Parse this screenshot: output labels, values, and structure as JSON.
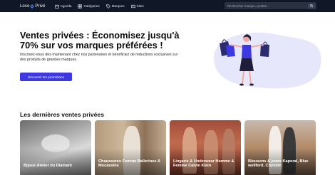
{
  "header": {
    "brand_left": "Loco",
    "brand_right": "Privé",
    "links": [
      {
        "label": "Agenda",
        "icon": "calendar-icon"
      },
      {
        "label": "Catégories",
        "icon": "grid-icon"
      },
      {
        "label": "Marques",
        "icon": "tag-icon"
      },
      {
        "label": "Sites",
        "icon": "sites-icon"
      }
    ],
    "search_placeholder": "Rechercher marque, produit..."
  },
  "hero": {
    "title": "Ventes privées : Économisez jusqu'à 70% sur vos marques préférées !",
    "subtitle": "Inscrivez-vous dès maintenant chez nos partenaires et bénéficiez de réductions exclusives sur des produits de grandes marques.",
    "cta_label": "Découvrir les promotions"
  },
  "sales": {
    "title": "Les dernières ventes privées",
    "cards": [
      {
        "title": "Bijoux Atelier du Diamant"
      },
      {
        "title": "Chaussures Femme Ballerines & Mocassins"
      },
      {
        "title": "Lingerie & Underwear Homme & Femme Calvin Klein"
      },
      {
        "title": "Blousons & jeans Kaporal, Blue wellford, Chyston"
      }
    ]
  },
  "colors": {
    "navbar": "#101828",
    "accent": "#3d38e0",
    "illustration_blob": "#e6e7fb",
    "shopping_bag": "#2b2b6e"
  }
}
